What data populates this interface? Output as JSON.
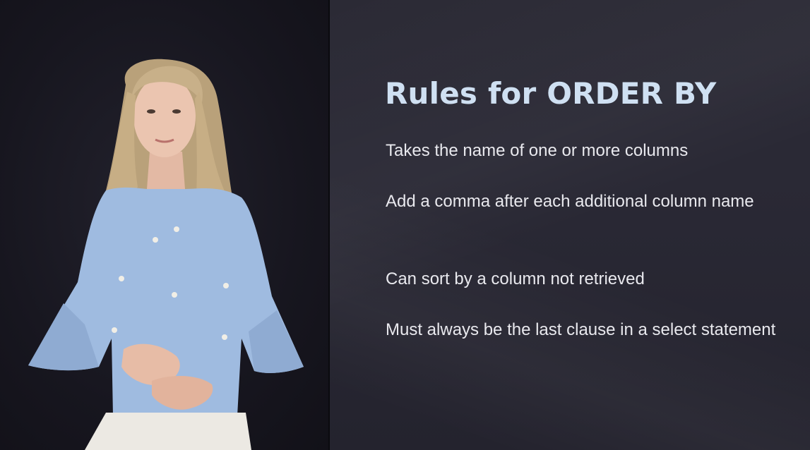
{
  "slide": {
    "title": "Rules for ORDER BY",
    "bullets": [
      "Takes the name of one or more columns",
      "Add a comma after each additional column name",
      "Can sort by a column not retrieved",
      "Must always be the last clause in a select statement"
    ]
  },
  "colors": {
    "title": "#cfe0f2",
    "text": "#e9e9ee",
    "slide_background": "#2a2935",
    "presenter_background": "#17161f"
  }
}
